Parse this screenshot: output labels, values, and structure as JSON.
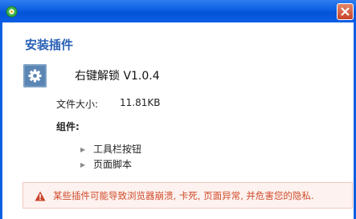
{
  "dialog": {
    "heading": "安装插件"
  },
  "plugin": {
    "icon": "gear-icon",
    "name": "右键解锁 V1.0.4",
    "size_label": "文件大小:",
    "size_value": "11.81KB",
    "components_label": "组件:",
    "components": [
      "工具栏按钮",
      "页面脚本"
    ]
  },
  "warning": {
    "icon": "warning-triangle-icon",
    "text": "某些插件可能导致浏览器崩溃, 卡死, 页面异常, 并危害您的隐私."
  },
  "colors": {
    "titlebar": "#0b5fe0",
    "heading": "#2a61b6",
    "warning_text": "#d04a2a",
    "warning_bg": "#fdf2ef"
  }
}
